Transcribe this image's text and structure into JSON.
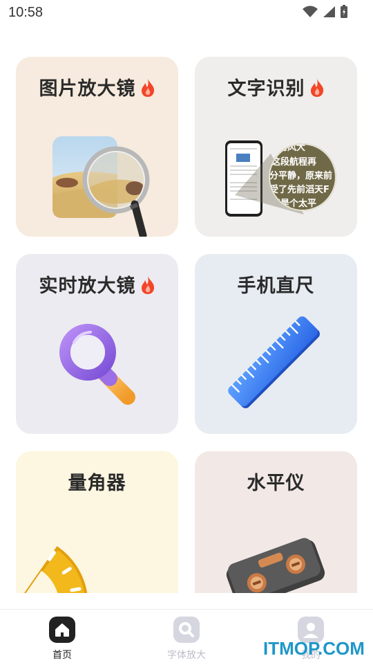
{
  "status_bar": {
    "time": "10:58"
  },
  "tools": [
    {
      "title": "图片放大镜",
      "hot": true,
      "bg": "#f6ebde",
      "illustration": "magnifier-photo-illustration"
    },
    {
      "title": "文字识别",
      "hot": true,
      "bg": "#efeeec",
      "illustration": "text-recognition-illustration",
      "magnified_text": [
        "面的风大",
        "这段航程再",
        "分平静，原来前",
        "受了先前滔天F",
        "真是个太平"
      ]
    },
    {
      "title": "实时放大镜",
      "hot": true,
      "bg": "#ecebf1",
      "illustration": "purple-magnifier-illustration"
    },
    {
      "title": "手机直尺",
      "hot": false,
      "bg": "#e6ecf1",
      "illustration": "ruler-illustration"
    },
    {
      "title": "量角器",
      "hot": false,
      "bg": "#fdf6e0",
      "illustration": "protractor-illustration"
    },
    {
      "title": "水平仪",
      "hot": false,
      "bg": "#f2e9e6",
      "illustration": "spirit-level-illustration"
    }
  ],
  "bottom_nav": {
    "items": [
      {
        "label": "首页",
        "icon": "home-icon",
        "active": true
      },
      {
        "label": "字体放大",
        "icon": "search-icon",
        "active": false
      },
      {
        "label": "我的",
        "icon": "user-icon",
        "active": false
      }
    ]
  },
  "watermark": "ITMOP.COM",
  "colors": {
    "active": "#222222",
    "inactive": "#bdbdc9",
    "fire": "#f2452a",
    "watermark": "#1e97c8"
  }
}
